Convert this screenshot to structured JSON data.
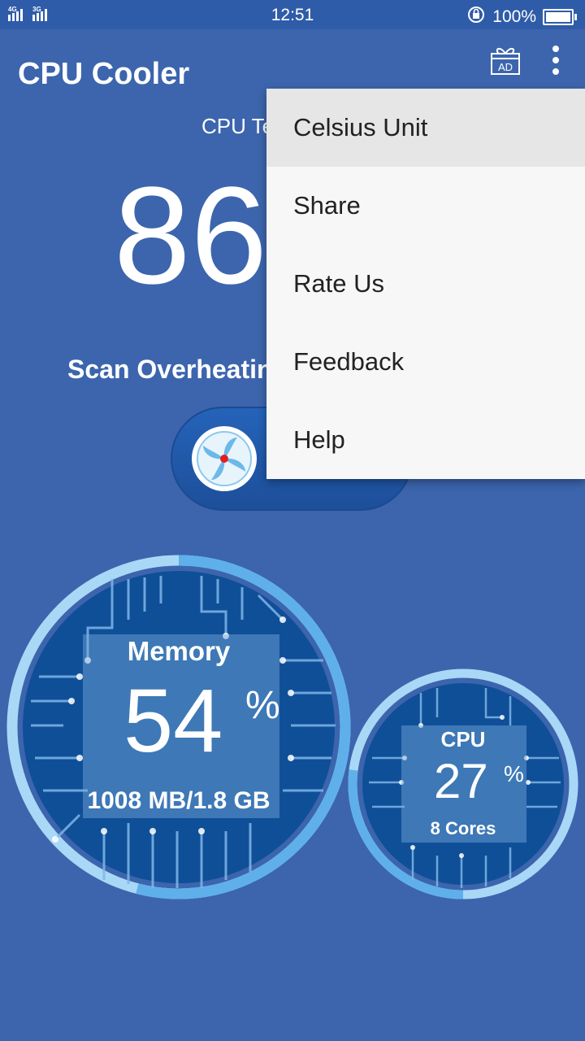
{
  "status_bar": {
    "network": "4G 3G",
    "time": "12:51",
    "battery": "100%"
  },
  "app_bar": {
    "title": "CPU Cooler",
    "ad_label": "AD"
  },
  "temperature": {
    "label": "CPU Te",
    "value": "86"
  },
  "scan": {
    "text": "Scan Overheatin"
  },
  "memory": {
    "title": "Memory",
    "value": "54",
    "unit": "%",
    "detail": "1008 MB/1.8 GB",
    "fraction": 0.54
  },
  "cpu": {
    "title": "CPU",
    "value": "27",
    "unit": "%",
    "detail": "8 Cores",
    "fraction": 0.27
  },
  "menu": {
    "items": [
      {
        "label": "Celsius Unit"
      },
      {
        "label": "Share"
      },
      {
        "label": "Rate Us"
      },
      {
        "label": "Feedback"
      },
      {
        "label": "Help"
      }
    ]
  },
  "colors": {
    "background": "#3c65ad",
    "gauge_ring": "#a9d8f7",
    "gauge_progress": "#5fb0ea",
    "gauge_inner": "#0f4f98"
  }
}
